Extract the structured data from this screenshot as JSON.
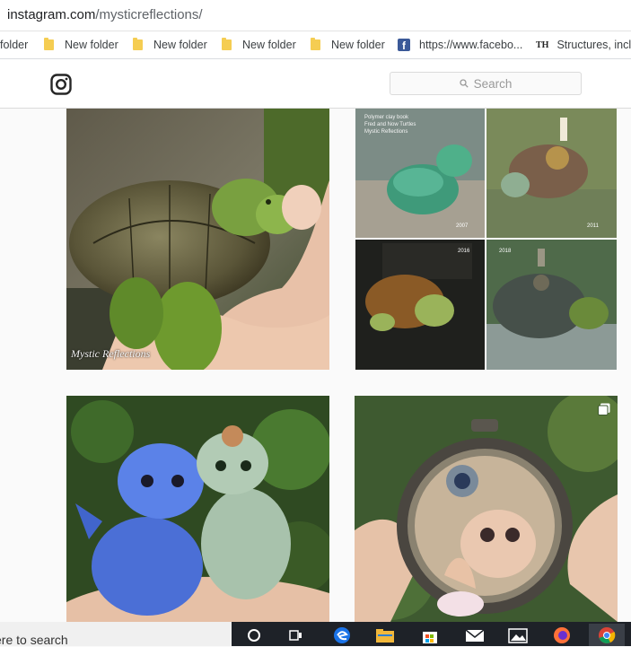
{
  "browser": {
    "url_host": "instagram.com",
    "url_path": "/mysticreflections/"
  },
  "bookmarks": [
    {
      "label": "folder",
      "icon": "folder-icon"
    },
    {
      "label": "New folder",
      "icon": "folder-icon"
    },
    {
      "label": "New folder",
      "icon": "folder-icon"
    },
    {
      "label": "New folder",
      "icon": "folder-icon"
    },
    {
      "label": "New folder",
      "icon": "folder-icon"
    },
    {
      "label": "https://www.facebo...",
      "icon": "facebook-icon"
    },
    {
      "label": "Structures, inclu",
      "icon": "th-icon",
      "icon_text": "TH"
    }
  ],
  "header": {
    "logo_icon": "instagram-logo-icon",
    "search_placeholder": "Search"
  },
  "posts": [
    {
      "caption": "Mystic Reflections",
      "subject": "clay-tortoise-in-hand"
    },
    {
      "subject": "tortoise-collage",
      "collage_title": "Polymer clay book\nFred and Now Turtles\nMystic Reflections",
      "years": [
        "2007",
        "2011",
        "2016",
        "2018"
      ]
    },
    {
      "subject": "clay-dragons-in-hand"
    },
    {
      "subject": "pocket-watch-fairy",
      "multi_icon": "multiple-images-icon"
    }
  ],
  "taskbar": {
    "search_text": "ere to search",
    "icons": [
      "cortana-circle-icon",
      "task-view-icon",
      "edge-icon",
      "file-explorer-icon",
      "store-icon",
      "mail-icon",
      "photos-icon",
      "firefox-icon",
      "chrome-icon"
    ]
  },
  "colors": {
    "taskbar_bg": "#1e2228",
    "link_text": "#202124",
    "facebook": "#3b5998",
    "folder": "#f5cd52"
  }
}
